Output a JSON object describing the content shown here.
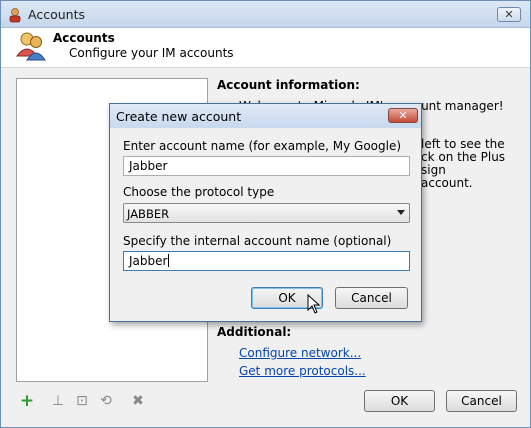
{
  "window": {
    "title": "Accounts",
    "close_label": "✕",
    "header_title": "Accounts",
    "header_subtitle": "Configure your IM accounts"
  },
  "info": {
    "title": "Account information:",
    "line1": "Welcome to Miranda IM's account manager!",
    "line2": "left to see the",
    "line3": "ck on the Plus sign",
    "line4": "account."
  },
  "additional": {
    "title": "Additional:",
    "link1": "Configure network...",
    "link2": "Get more protocols..."
  },
  "buttons": {
    "ok": "OK",
    "cancel": "Cancel"
  },
  "toolbar": {
    "add": "+",
    "rename": "⊥",
    "options": "⊡",
    "upgrade": "⟲",
    "delete": "✖"
  },
  "dialog": {
    "title": "Create new account",
    "close_label": "✕",
    "name_label": "Enter account name (for example, My Google)",
    "name_value": "Jabber",
    "protocol_label": "Choose the protocol type",
    "protocol_value": "JABBER",
    "internal_label": "Specify the internal account name (optional)",
    "internal_value": "Jabber",
    "ok": "OK",
    "cancel": "Cancel"
  }
}
